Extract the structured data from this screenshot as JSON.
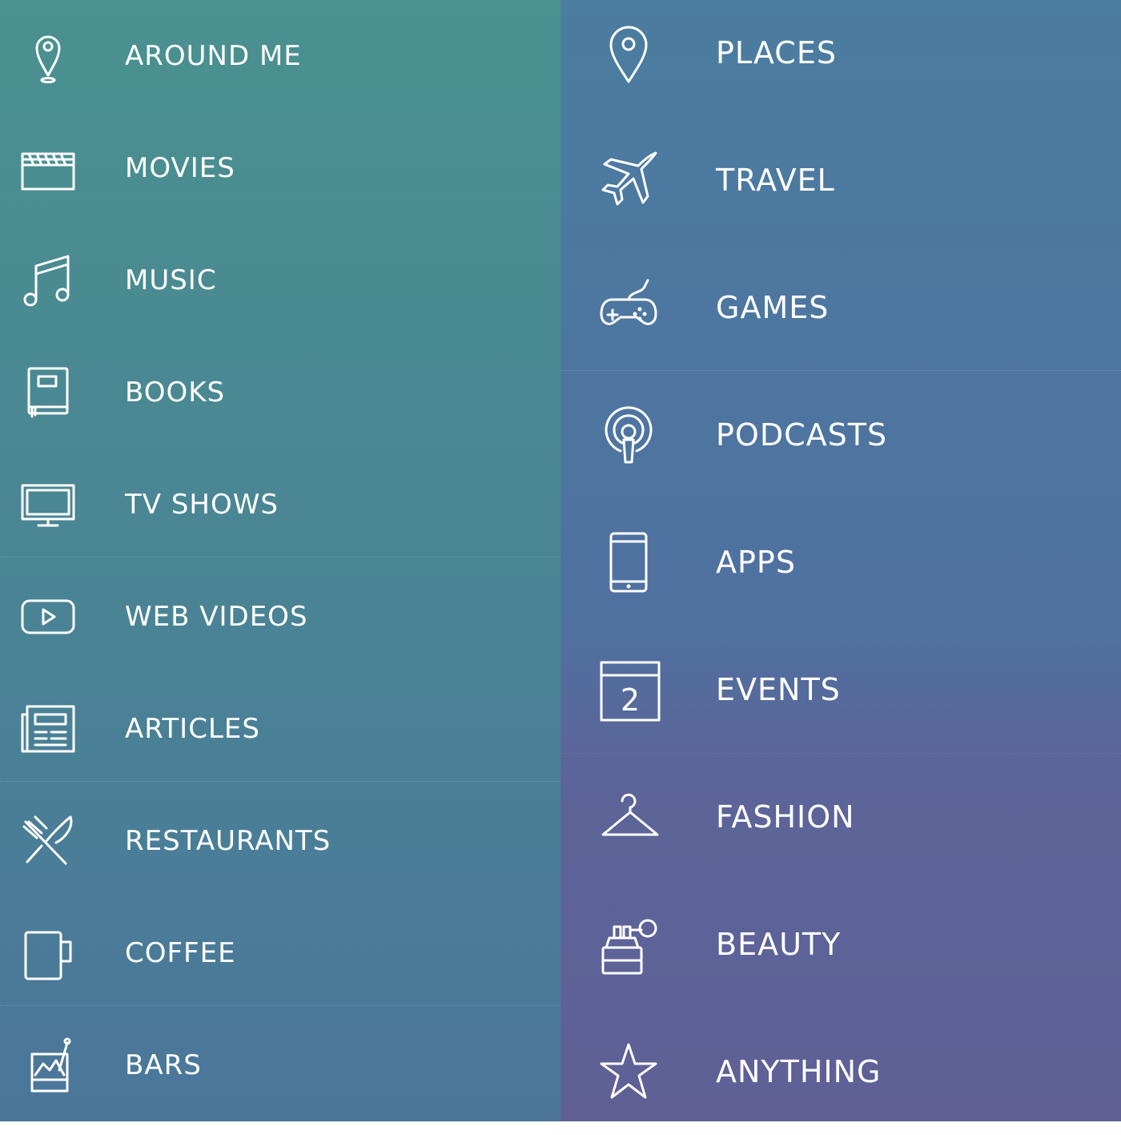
{
  "left_column": {
    "items": [
      {
        "label": "AROUND ME",
        "icon": "location-pin-icon"
      },
      {
        "label": "MOVIES",
        "icon": "clapperboard-icon"
      },
      {
        "label": "MUSIC",
        "icon": "music-note-icon"
      },
      {
        "label": "BOOKS",
        "icon": "book-icon"
      },
      {
        "label": "TV SHOWS",
        "icon": "tv-icon"
      },
      {
        "label": "WEB VIDEOS",
        "icon": "play-video-icon"
      },
      {
        "label": "ARTICLES",
        "icon": "newspaper-icon"
      },
      {
        "label": "RESTAURANTS",
        "icon": "fork-knife-icon"
      },
      {
        "label": "COFFEE",
        "icon": "mug-icon"
      },
      {
        "label": "BARS",
        "icon": "cocktail-icon"
      }
    ]
  },
  "right_column": {
    "items": [
      {
        "label": "PLACES",
        "icon": "map-pin-icon"
      },
      {
        "label": "TRAVEL",
        "icon": "airplane-icon"
      },
      {
        "label": "GAMES",
        "icon": "gamepad-icon"
      },
      {
        "label": "PODCASTS",
        "icon": "podcast-icon"
      },
      {
        "label": "APPS",
        "icon": "phone-icon"
      },
      {
        "label": "EVENTS",
        "icon": "calendar-icon",
        "icon_text": "2"
      },
      {
        "label": "FASHION",
        "icon": "hanger-icon"
      },
      {
        "label": "BEAUTY",
        "icon": "perfume-icon"
      },
      {
        "label": "ANYTHING",
        "icon": "star-icon"
      }
    ]
  },
  "colors": {
    "left_top": "#4a9190",
    "left_bottom": "#4b769a",
    "right_top": "#4b7da0",
    "right_bottom": "#5f5f96",
    "text": "#ffffff"
  }
}
